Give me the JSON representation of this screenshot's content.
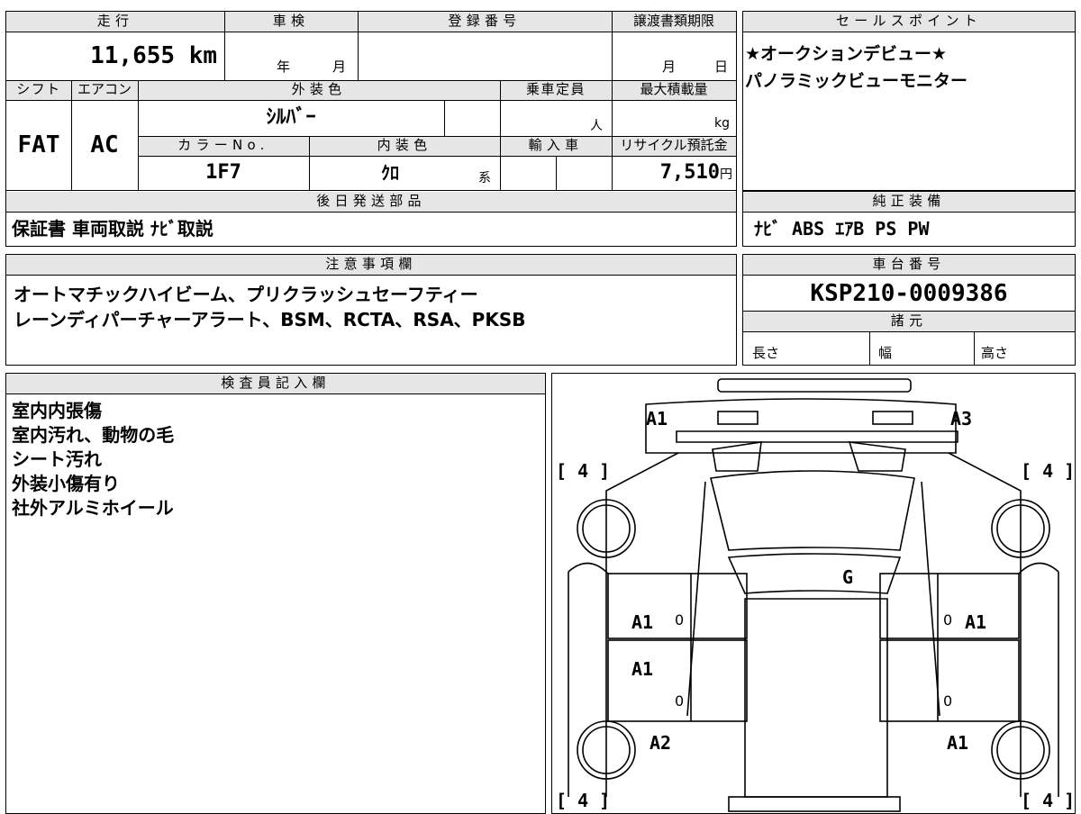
{
  "top_right": {
    "headers": {
      "mileage": "走行",
      "shaken": "車検",
      "registration_no": "登録番号",
      "transfer_deadline": "譲渡書類期限",
      "shift": "シフト",
      "aircon": "エアコン",
      "exterior_color": "外装色",
      "capacity": "乗車定員",
      "max_load": "最大積載量",
      "color_no": "カラーNo.",
      "interior_color": "内装色",
      "import": "輸入車",
      "recycle": "リサイクル預託金",
      "later_parts": "後日発送部品"
    }
  },
  "values": {
    "mileage": "11,655",
    "mileage_unit": "km",
    "year_unit": "年",
    "month_unit": "月",
    "deadline_month": "月",
    "deadline_day": "日",
    "shift": "FAT",
    "aircon": "AC",
    "exterior_color": "ｼﾙﾊﾞｰ",
    "capacity_unit": "人",
    "load_unit": "kg",
    "color_no": "1F7",
    "interior_color": "ｸﾛ",
    "interior_suffix": "系",
    "recycle_fee": "7,510",
    "yen_unit": "円",
    "later_parts": "保証書 車両取説 ﾅﾋﾞ取説"
  },
  "sales_point": {
    "title": "セールスポイント",
    "lines": [
      "★オークションデビュー★",
      "パノラミックビューモニター"
    ]
  },
  "equipment": {
    "title": "純正装備",
    "value": "ﾅﾋﾞ ABS ｴｱB PS PW"
  },
  "notes": {
    "title": "注意事項欄",
    "lines": [
      "オートマチックハイビーム、プリクラッシュセーフティー",
      "レーンディパーチャーアラート、BSM、RCTA、RSA、PKSB"
    ]
  },
  "chassis": {
    "title": "車台番号",
    "value": "KSP210-0009386",
    "spec_title": "諸元",
    "length": "長さ",
    "width": "幅",
    "height": "高さ"
  },
  "inspector": {
    "title": "検査員記入欄",
    "lines": [
      "室内内張傷",
      "室内汚れ、動物の毛",
      "シート汚れ",
      "外装小傷有り",
      "社外アルミホイール"
    ]
  },
  "diagram": {
    "marks": {
      "front_left": "A1",
      "front_right": "A3",
      "roof": "G",
      "left_front_door": "A1",
      "left_rear_door": "A1",
      "right_front_door": "A1",
      "left_rear": "A2",
      "right_rear": "A1",
      "tire_fl": "[ 4 ]",
      "tire_fr": "[ 4 ]",
      "tire_rl": "[ 4 ]",
      "tire_rr": "[ 4 ]",
      "zero_1": "0",
      "zero_2": "0",
      "zero_3": "0",
      "zero_4": "0"
    }
  }
}
